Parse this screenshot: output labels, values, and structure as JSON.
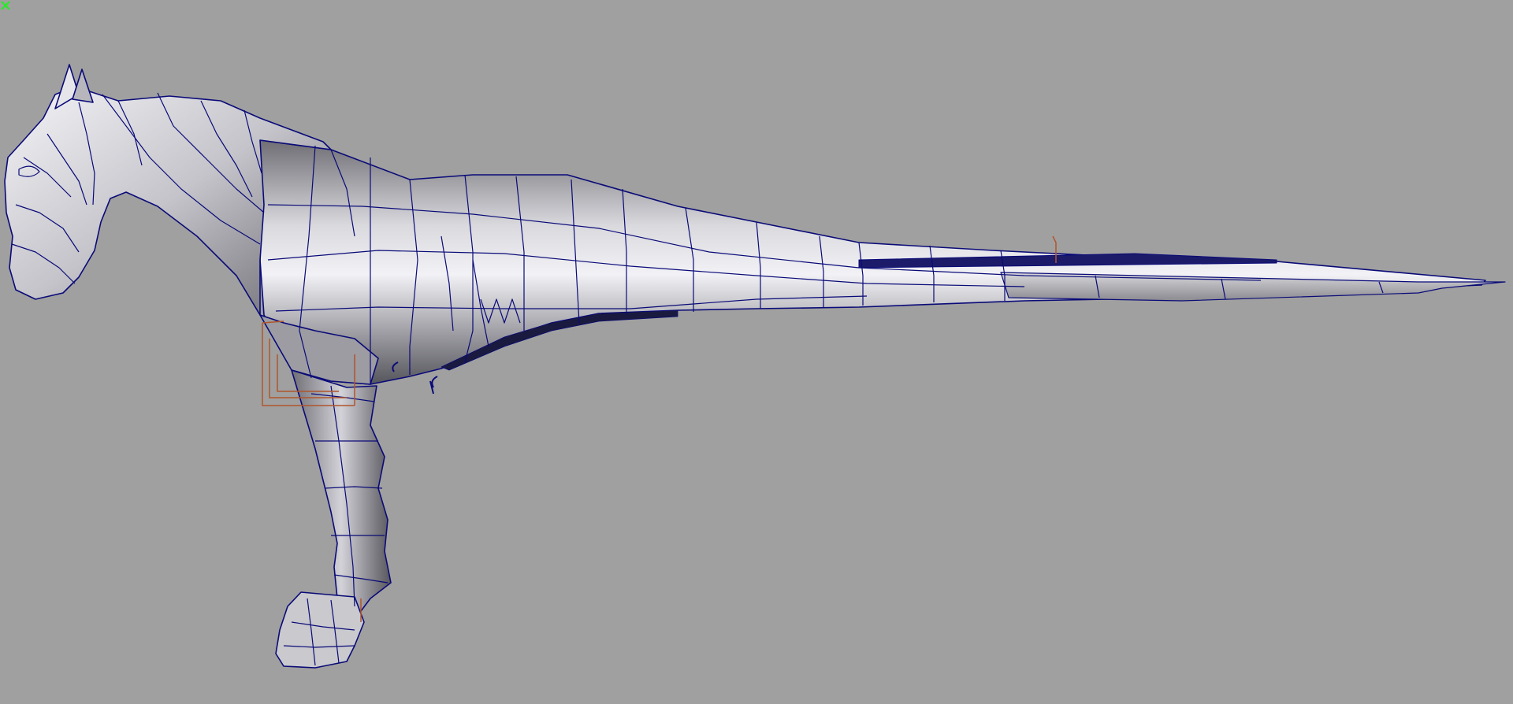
{
  "viewport": {
    "background_color": "#a0a0a0",
    "mesh_fill_color": "#c8c8cc",
    "mesh_shade_color": "#7c7c82",
    "mesh_highlight_color": "#f4f4f8",
    "wireframe_color": "#0a0a78",
    "selection_color": "#b0552c",
    "axis_gizmo_color": "#22ee22"
  },
  "objects": {
    "model": "horse-mesh-icon",
    "helpers": [
      "joint-locator-icon",
      "pivot-handle-icon"
    ],
    "axis_gizmo": "xyz-axis-gizmo-icon"
  }
}
